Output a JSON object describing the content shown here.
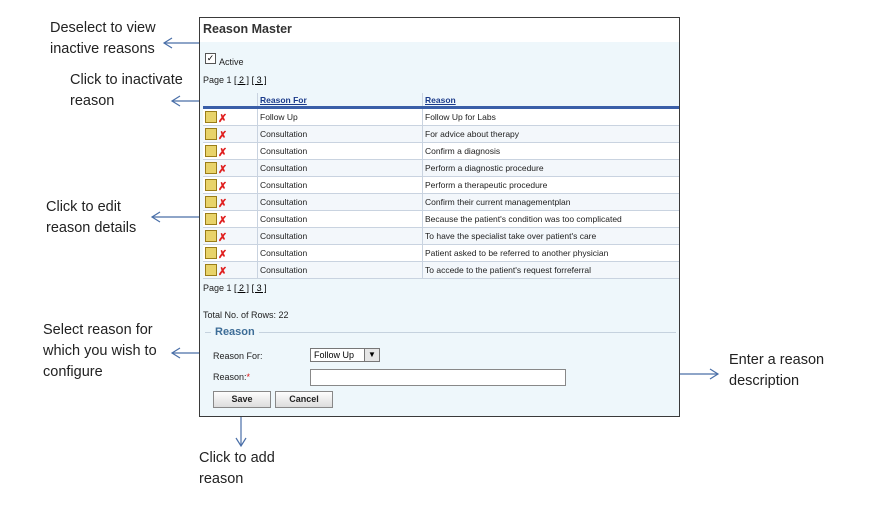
{
  "callouts": {
    "deselect": [
      "Deselect  to view",
      "inactive reasons"
    ],
    "inactivate": [
      "Click to inactivate",
      "reason"
    ],
    "edit": [
      "Click to edit",
      "reason details"
    ],
    "select_reason": [
      "Select reason for",
      "which you wish to",
      "configure"
    ],
    "enter_desc": [
      "Enter a reason",
      "description"
    ],
    "add": [
      "Click to add",
      "reason"
    ]
  },
  "panel": {
    "title": "Reason Master",
    "active_label": "Active",
    "active_checked": true,
    "pager": {
      "prefix": "Page 1",
      "pages": [
        "[ 2 ]",
        "[ 3 ]"
      ]
    },
    "columns": {
      "reason_for": "Reason For",
      "reason": "Reason"
    },
    "rows": [
      {
        "reason_for": "Follow Up",
        "reason": "Follow Up for Labs"
      },
      {
        "reason_for": "Consultation",
        "reason": "For advice about therapy"
      },
      {
        "reason_for": "Consultation",
        "reason": "Confirm a diagnosis"
      },
      {
        "reason_for": "Consultation",
        "reason": "Perform a diagnostic procedure"
      },
      {
        "reason_for": "Consultation",
        "reason": "Perform a therapeutic procedure"
      },
      {
        "reason_for": "Consultation",
        "reason": "Confirm their current managementplan"
      },
      {
        "reason_for": "Consultation",
        "reason": "Because the patient's condition was too complicated"
      },
      {
        "reason_for": "Consultation",
        "reason": "To have the specialist take over patient's care"
      },
      {
        "reason_for": "Consultation",
        "reason": "Patient asked to be referred to another physician"
      },
      {
        "reason_for": "Consultation",
        "reason": "To accede to the patient's request forreferral"
      }
    ],
    "total_rows": "Total No. of Rows: 22",
    "form": {
      "legend": "Reason",
      "reason_for_label": "Reason For:",
      "reason_for_value": "Follow Up",
      "reason_label": "Reason:",
      "required_mark": "*",
      "reason_value": "",
      "save_label": "Save",
      "cancel_label": "Cancel"
    }
  },
  "icons": {
    "edit": "edit-icon",
    "inactivate": "delete-x-icon",
    "dropdown": "chevron-down-icon"
  },
  "colors": {
    "accent": "#3a5fa8",
    "panel_bg": "#eef7fb",
    "delete": "#e02020",
    "legend": "#3d6d97",
    "arrow": "#4a6fa8"
  }
}
